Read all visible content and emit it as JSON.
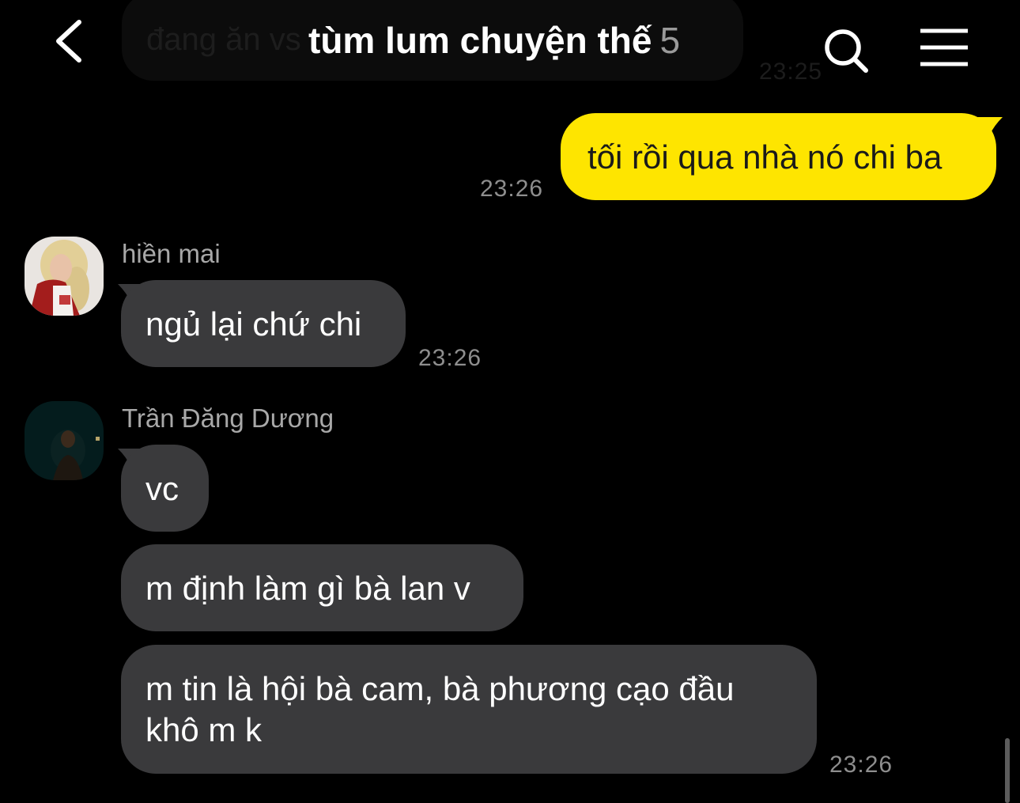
{
  "header": {
    "title": "tùm lum chuyện thế",
    "member_count": "5",
    "back_icon": "chevron-left-icon",
    "search_icon": "search-icon",
    "menu_icon": "hamburger-menu-icon"
  },
  "previous_message": {
    "text": "đang ăn vs",
    "time": "23:25"
  },
  "messages": [
    {
      "direction": "out",
      "text": "tối rồi qua nhà nó chi ba",
      "time": "23:26"
    },
    {
      "direction": "in",
      "sender": "hiền mai",
      "text": "ngủ lại chứ chi",
      "time": "23:26"
    },
    {
      "direction": "in",
      "sender": "Trần Đăng Dương",
      "texts": [
        "vc",
        "m định làm gì bà lan v",
        "m tin là hội bà cam, bà phương cạo đầu khô m k"
      ],
      "time": "23:26"
    }
  ],
  "colors": {
    "background": "#000000",
    "outgoing_bubble": "#fee500",
    "incoming_bubble": "#3a3a3c",
    "timestamp": "#8e8e8e",
    "sender_name": "#a8a8a8"
  }
}
